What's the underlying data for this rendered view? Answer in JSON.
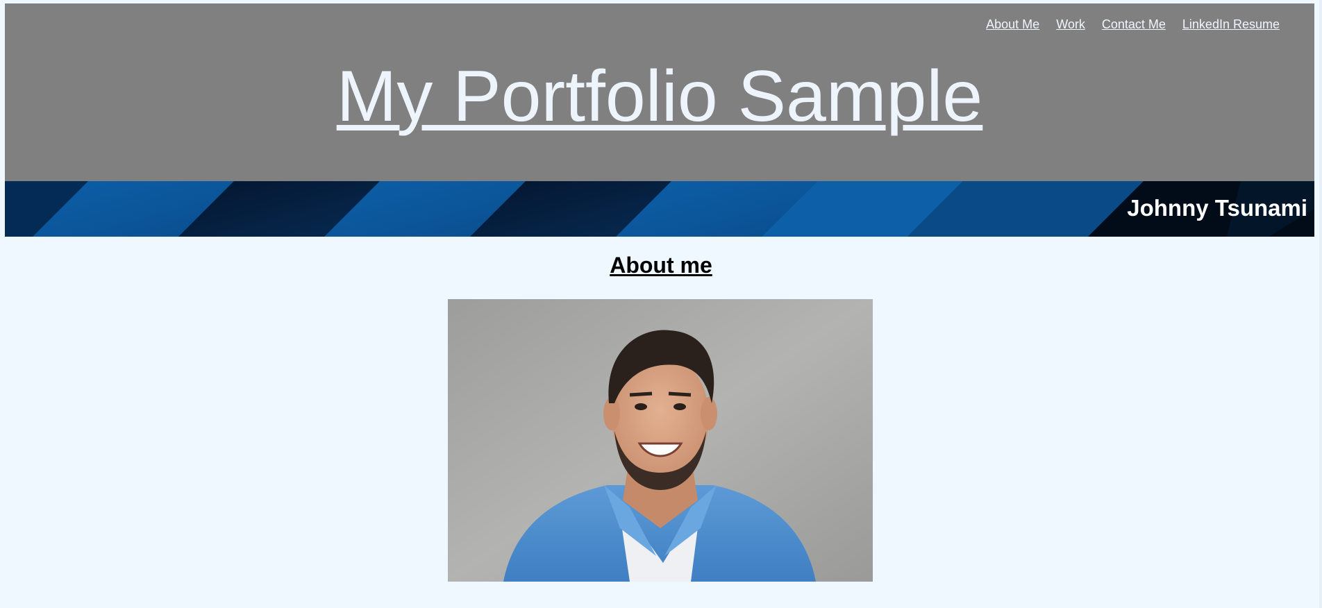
{
  "nav": {
    "items": [
      {
        "label": "About Me"
      },
      {
        "label": "Work"
      },
      {
        "label": "Contact Me"
      },
      {
        "label": "LinkedIn Resume"
      }
    ]
  },
  "header": {
    "title": "My Portfolio Sample"
  },
  "banner": {
    "name": "Johnny Tsunami"
  },
  "about": {
    "heading": "About me"
  },
  "colors": {
    "background": "#eff7ff",
    "header_bg": "#808080",
    "banner_dark": "#03203f",
    "banner_blue": "#0b5aa0",
    "text_light": "#eef4fc"
  }
}
